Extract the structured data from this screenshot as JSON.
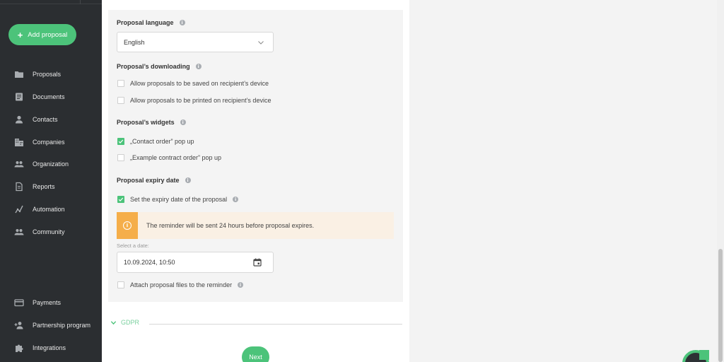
{
  "sidebar": {
    "add_proposal": "Add proposal",
    "items": [
      {
        "label": "Proposals",
        "icon": "folder-icon"
      },
      {
        "label": "Documents",
        "icon": "document-icon"
      },
      {
        "label": "Contacts",
        "icon": "person-icon"
      },
      {
        "label": "Companies",
        "icon": "building-icon"
      },
      {
        "label": "Organization",
        "icon": "people-icon"
      },
      {
        "label": "Reports",
        "icon": "report-icon"
      },
      {
        "label": "Automation",
        "icon": "automation-icon"
      },
      {
        "label": "Community",
        "icon": "community-icon"
      }
    ],
    "bottom_items": [
      {
        "label": "Payments",
        "icon": "credit-card-icon"
      },
      {
        "label": "Partnership program",
        "icon": "person-add-icon"
      },
      {
        "label": "Integrations",
        "icon": "puzzle-icon"
      }
    ]
  },
  "form": {
    "language": {
      "title": "Proposal language",
      "value": "English"
    },
    "downloading": {
      "title": "Proposal’s downloading",
      "options": [
        {
          "label": "Allow proposals to be saved on recipient’s device",
          "checked": false
        },
        {
          "label": "Allow proposals to be printed on recipient’s device",
          "checked": false
        }
      ]
    },
    "widgets": {
      "title": "Proposal’s widgets",
      "options": [
        {
          "label": "„Contact order” pop up",
          "checked": true
        },
        {
          "label": "„Example contract order” pop up",
          "checked": false
        }
      ]
    },
    "expiry": {
      "title": "Proposal expiry date",
      "set_label": "Set the expiry date of the proposal",
      "set_checked": true,
      "notice": "The reminder will be sent 24 hours before proposal expires.",
      "date_label": "Select a date:",
      "date_value": "10.09.2024, 10:50",
      "attach_label": "Attach proposal files to the reminder",
      "attach_checked": false
    },
    "gdpr_label": "GDPR",
    "next_label": "Next"
  },
  "colors": {
    "accent": "#4cc37a",
    "sidebar_bg": "#2b2e31",
    "warning": "#f5ae4a",
    "warning_bg": "#faf0e4"
  }
}
